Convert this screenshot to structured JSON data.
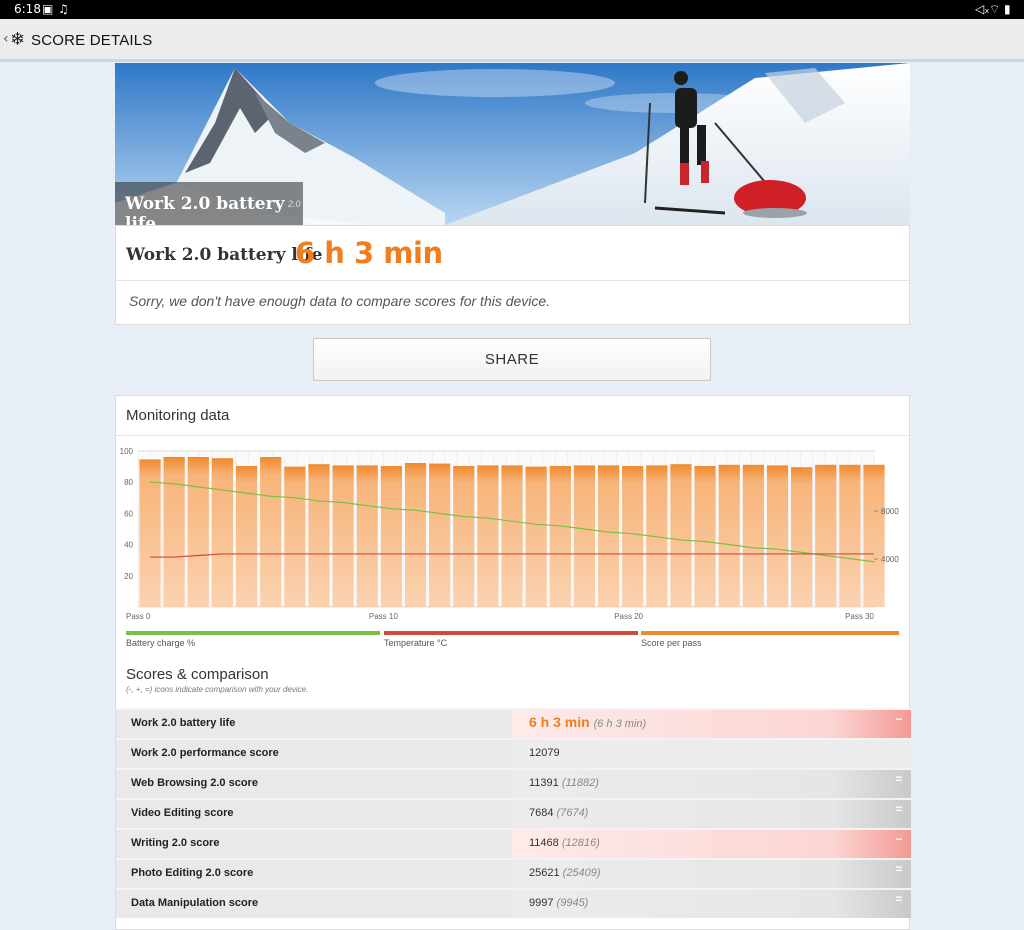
{
  "status_bar": {
    "time": "6:18",
    "left_icons": [
      "image-icon",
      "music-note-icon"
    ],
    "right_icons": [
      "mute-icon",
      "wifi-icon",
      "battery-icon"
    ]
  },
  "app_bar": {
    "title": "SCORE DETAILS"
  },
  "hero": {
    "caption": "Work 2.0 battery life",
    "version": "2.0"
  },
  "result": {
    "name": "Work 2.0 battery life",
    "value": "6 h 3 min",
    "note": "Sorry, we don't have enough data to compare scores for this device."
  },
  "share_label": "SHARE",
  "monitoring": {
    "title": "Monitoring data",
    "legend": [
      "Battery charge %",
      "Temperature °C",
      "Score per pass"
    ],
    "colors": {
      "battery": "#7dc144",
      "temperature": "#d24a3a",
      "score": "#f08a2e"
    }
  },
  "chart_data": {
    "type": "bar",
    "x_tick_labels": [
      "Pass 0",
      "Pass 10",
      "Pass 20",
      "Pass 30"
    ],
    "left_axis_ticks": [
      "100",
      "80",
      "60",
      "40",
      "20"
    ],
    "right_axis_ticks": [
      "8000",
      "4000"
    ],
    "series": [
      {
        "name": "Score per pass",
        "values": [
          12300,
          12500,
          12500,
          12400,
          11750,
          12500,
          11700,
          11900,
          11800,
          11800,
          11750,
          12000,
          11950,
          11750,
          11800,
          11800,
          11700,
          11750,
          11800,
          11800,
          11750,
          11800,
          11900,
          11750,
          11850,
          11850,
          11800,
          11650,
          11850,
          11850,
          11850
        ]
      },
      {
        "name": "Battery charge %",
        "values": [
          80,
          79,
          77,
          75,
          73,
          71,
          70,
          68,
          67,
          65,
          63,
          62,
          60,
          58,
          57,
          55,
          53,
          52,
          50,
          48,
          47,
          45,
          43,
          42,
          40,
          38,
          37,
          35,
          33,
          31,
          29
        ]
      },
      {
        "name": "Temperature °C",
        "values": [
          32,
          32,
          33,
          34,
          34,
          34,
          34,
          34,
          34,
          34,
          34,
          34,
          34,
          34,
          34,
          34,
          34,
          34,
          34,
          34,
          34,
          34,
          34,
          34,
          34,
          34,
          34,
          34,
          34,
          34,
          34
        ]
      }
    ],
    "ylim_left": [
      0,
      100
    ],
    "ylim_right": [
      0,
      13000
    ]
  },
  "scores": {
    "title": "Scores & comparison",
    "subtitle": "(-, +, =) icons indicate comparison with your device.",
    "rows": [
      {
        "label": "Work 2.0 battery life",
        "value": "6 h 3 min",
        "compare": "(6 h 3 min)",
        "indicator": "−",
        "style": "hot",
        "big": true
      },
      {
        "label": "Work 2.0 performance score",
        "value": "12079",
        "compare": "",
        "indicator": "",
        "style": "plain",
        "big": false
      },
      {
        "label": "Web Browsing 2.0 score",
        "value": "11391",
        "compare": "(11882)",
        "indicator": "=",
        "style": "gray",
        "big": false
      },
      {
        "label": "Video Editing score",
        "value": "7684",
        "compare": "(7674)",
        "indicator": "=",
        "style": "gray",
        "big": false
      },
      {
        "label": "Writing 2.0 score",
        "value": "11468",
        "compare": "(12816)",
        "indicator": "−",
        "style": "hot",
        "big": false
      },
      {
        "label": "Photo Editing 2.0 score",
        "value": "25621",
        "compare": "(25409)",
        "indicator": "=",
        "style": "gray",
        "big": false
      },
      {
        "label": "Data Manipulation score",
        "value": "9997",
        "compare": "(9945)",
        "indicator": "=",
        "style": "gray",
        "big": false
      }
    ]
  }
}
